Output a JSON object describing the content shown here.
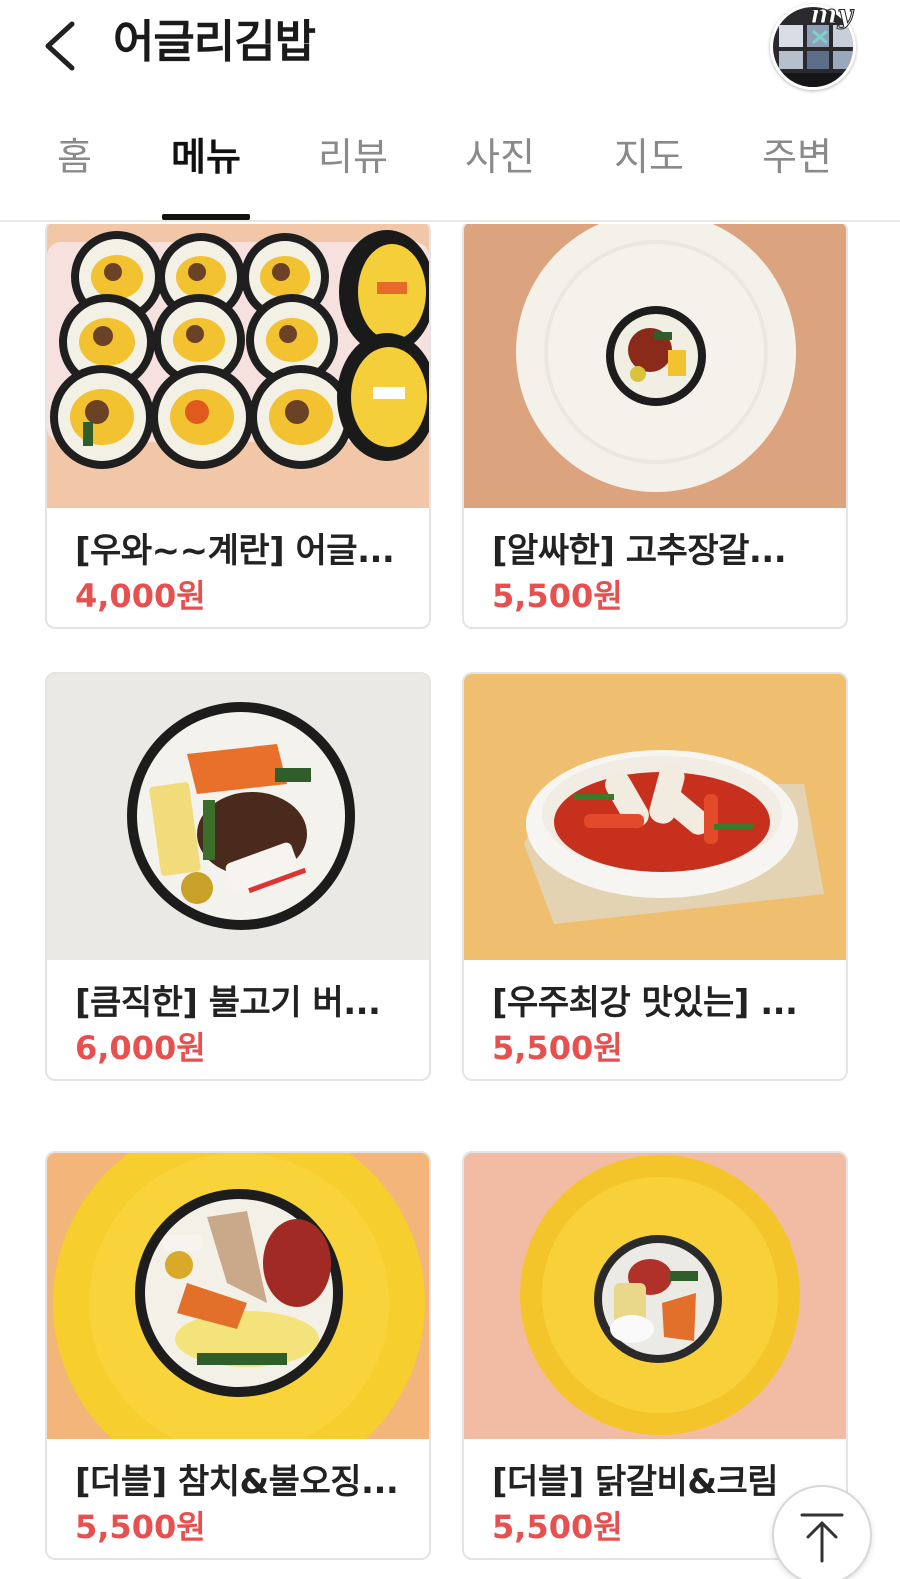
{
  "header": {
    "title": "어글리김밥",
    "back_icon": "chevron-left-icon",
    "avatar_label": "my"
  },
  "tabs": [
    {
      "label": "홈",
      "active": false
    },
    {
      "label": "메뉴",
      "active": true
    },
    {
      "label": "리뷰",
      "active": false
    },
    {
      "label": "사진",
      "active": false
    },
    {
      "label": "지도",
      "active": false
    },
    {
      "label": "주변",
      "active": false
    }
  ],
  "menu": [
    {
      "name": "[우와~~계란] 어글...",
      "price": "4,000원"
    },
    {
      "name": "[알싸한] 고추장갈...",
      "price": "5,500원"
    },
    {
      "name": "[큼직한] 불고기 버...",
      "price": "6,000원"
    },
    {
      "name": "[우주최강 맛있는] ...",
      "price": "5,500원"
    },
    {
      "name": "[더블] 참치&불오징...",
      "price": "5,500원"
    },
    {
      "name": "[더블] 닭갈비&크림",
      "price": "5,500원"
    }
  ],
  "scroll_top_icon": "arrow-up-icon",
  "colors": {
    "price": "#e8504f",
    "active_tab": "#111111",
    "inactive_tab": "#8a8a8a"
  }
}
